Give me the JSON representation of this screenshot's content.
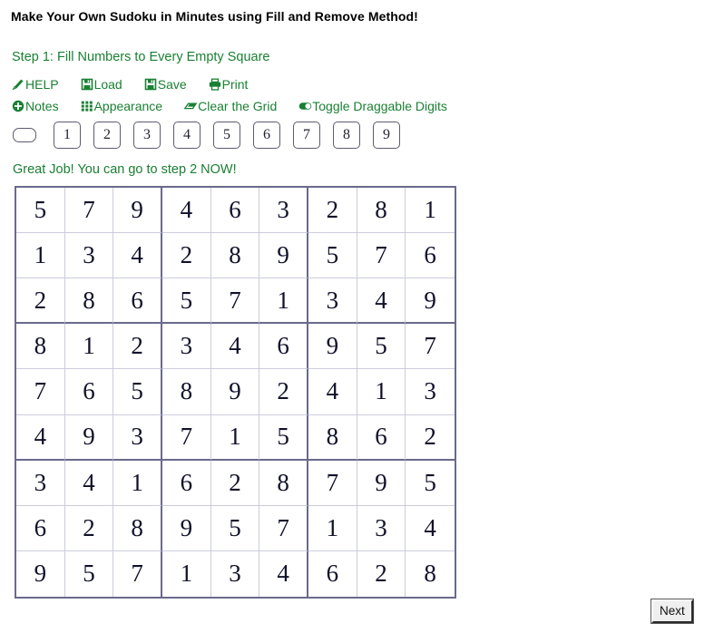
{
  "page": {
    "title": "Make Your Own Sudoku in Minutes using Fill and Remove Method!",
    "step_heading": "Step 1: Fill Numbers to Every Empty Square",
    "status_message": "Great Job! You can go to step 2 NOW!",
    "accent_color": "#1a8033",
    "title_color": "#000000",
    "grid_line_color": "#ccccdd",
    "grid_box_color": "#6a6a8c",
    "digit_color": "#10102a"
  },
  "toolbar": {
    "row1": [
      {
        "icon": "pencil-icon",
        "label": "HELP"
      },
      {
        "icon": "floppy-disk-load-icon",
        "label": "Load"
      },
      {
        "icon": "floppy-disk-save-icon",
        "label": "Save"
      },
      {
        "icon": "printer-icon",
        "label": "Print"
      }
    ],
    "row2": [
      {
        "icon": "plus-circle-icon",
        "label": "Notes"
      },
      {
        "icon": "grid-squares-icon",
        "label": "Appearance"
      },
      {
        "icon": "eraser-icon",
        "label": "Clear the Grid"
      },
      {
        "icon": "toggle-switch-icon",
        "label": "Toggle Draggable Digits"
      }
    ]
  },
  "digit_bar": {
    "blank_button": {
      "label": "",
      "name": "blank-digit-button"
    },
    "digits": [
      "1",
      "2",
      "3",
      "4",
      "5",
      "6",
      "7",
      "8",
      "9"
    ]
  },
  "grid": {
    "rows": [
      [
        "5",
        "7",
        "9",
        "4",
        "6",
        "3",
        "2",
        "8",
        "1"
      ],
      [
        "1",
        "3",
        "4",
        "2",
        "8",
        "9",
        "5",
        "7",
        "6"
      ],
      [
        "2",
        "8",
        "6",
        "5",
        "7",
        "1",
        "3",
        "4",
        "9"
      ],
      [
        "8",
        "1",
        "2",
        "3",
        "4",
        "6",
        "9",
        "5",
        "7"
      ],
      [
        "7",
        "6",
        "5",
        "8",
        "9",
        "2",
        "4",
        "1",
        "3"
      ],
      [
        "4",
        "9",
        "3",
        "7",
        "1",
        "5",
        "8",
        "6",
        "2"
      ],
      [
        "3",
        "4",
        "1",
        "6",
        "2",
        "8",
        "7",
        "9",
        "5"
      ],
      [
        "6",
        "2",
        "8",
        "9",
        "5",
        "7",
        "1",
        "3",
        "4"
      ],
      [
        "9",
        "5",
        "7",
        "1",
        "3",
        "4",
        "6",
        "2",
        "8"
      ]
    ]
  },
  "footer": {
    "next_label": "Next"
  }
}
